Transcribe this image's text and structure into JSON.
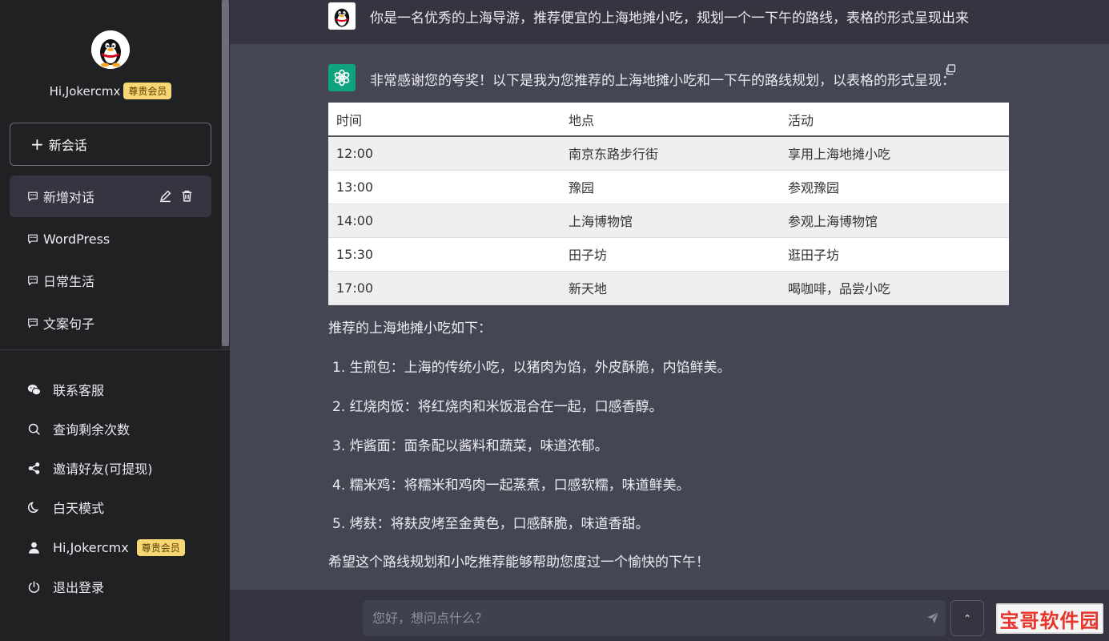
{
  "sidebar": {
    "greeting": "Hi,Jokercmx",
    "badge": "尊贵会员",
    "new_chat": "新会话",
    "conversations": [
      {
        "label": "新增对话",
        "active": true
      },
      {
        "label": "WordPress",
        "active": false
      },
      {
        "label": "日常生活",
        "active": false
      },
      {
        "label": "文案句子",
        "active": false
      }
    ],
    "menu": {
      "contact": "联系客服",
      "query": "查询剩余次数",
      "invite": "邀请好友(可提现)",
      "daymode": "白天模式",
      "user": "Hi,Jokercmx",
      "user_badge": "尊贵会员",
      "logout": "退出登录"
    }
  },
  "chat": {
    "user_message": "你是一名优秀的上海导游，推荐便宜的上海地摊小吃，规划一个一下午的路线，表格的形式呈现出来",
    "bot_intro": "非常感谢您的夸奖！以下是我为您推荐的上海地摊小吃和一下午的路线规划，以表格的形式呈现：",
    "table": {
      "headers": [
        "时间",
        "地点",
        "活动"
      ],
      "rows": [
        [
          "12:00",
          "南京东路步行街",
          "享用上海地摊小吃"
        ],
        [
          "13:00",
          "豫园",
          "参观豫园"
        ],
        [
          "14:00",
          "上海博物馆",
          "参观上海博物馆"
        ],
        [
          "15:30",
          "田子坊",
          "逛田子坊"
        ],
        [
          "17:00",
          "新天地",
          "喝咖啡，品尝小吃"
        ]
      ]
    },
    "list_intro": "推荐的上海地摊小吃如下：",
    "list": [
      "1. 生煎包：上海的传统小吃，以猪肉为馅，外皮酥脆，内馅鲜美。",
      "2. 红烧肉饭：将红烧肉和米饭混合在一起，口感香醇。",
      "3. 炸酱面：面条配以酱料和蔬菜，味道浓郁。",
      "4. 糯米鸡：将糯米和鸡肉一起蒸煮，口感软糯，味道鲜美。",
      "5. 烤麸：将麸皮烤至金黄色，口感酥脆，味道香甜。"
    ],
    "closing": "希望这个路线规划和小吃推荐能够帮助您度过一个愉快的下午！"
  },
  "input": {
    "placeholder": "您好，想问点什么？",
    "value": ""
  },
  "watermark": "宝哥软件园",
  "colors": {
    "sidebar_bg": "#202123",
    "main_bg": "#444654",
    "user_band": "#343541",
    "badge": "#f7d774",
    "bot_avatar": "#10a37f",
    "watermark_text": "#e8342b"
  }
}
